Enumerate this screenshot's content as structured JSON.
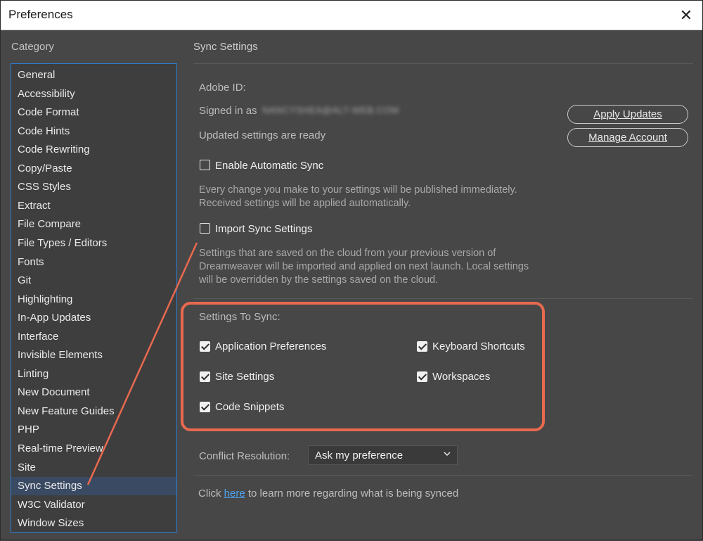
{
  "window": {
    "title": "Preferences",
    "close_glyph": "✕"
  },
  "sidebar": {
    "header": "Category",
    "items": [
      {
        "label": "General"
      },
      {
        "label": "Accessibility"
      },
      {
        "label": "Code Format"
      },
      {
        "label": "Code Hints"
      },
      {
        "label": "Code Rewriting"
      },
      {
        "label": "Copy/Paste"
      },
      {
        "label": "CSS Styles"
      },
      {
        "label": "Extract"
      },
      {
        "label": "File Compare"
      },
      {
        "label": "File Types / Editors"
      },
      {
        "label": "Fonts"
      },
      {
        "label": "Git"
      },
      {
        "label": "Highlighting"
      },
      {
        "label": "In-App Updates"
      },
      {
        "label": "Interface"
      },
      {
        "label": "Invisible Elements"
      },
      {
        "label": "Linting"
      },
      {
        "label": "New Document"
      },
      {
        "label": "New Feature Guides"
      },
      {
        "label": "PHP"
      },
      {
        "label": "Real-time Preview"
      },
      {
        "label": "Site"
      },
      {
        "label": "Sync Settings",
        "selected": true
      },
      {
        "label": "W3C Validator"
      },
      {
        "label": "Window Sizes"
      }
    ]
  },
  "main": {
    "section_title": "Sync Settings",
    "adobe_id_label": "Adobe ID:",
    "signed_in_label": "Signed in as",
    "signed_in_email": "NANCYSHEA@ALT-WEB.COM",
    "updated_status": "Updated settings are ready",
    "apply_updates_button": "Apply Updates",
    "manage_account_button": "Manage Account",
    "enable_auto_sync": {
      "label": "Enable Automatic Sync",
      "checked": false
    },
    "enable_auto_sync_desc_line1": "Every change you make to your settings will be published immediately.",
    "enable_auto_sync_desc_line2": "Received settings will be applied automatically.",
    "import_sync": {
      "label": "Import Sync Settings",
      "checked": false
    },
    "import_sync_desc_line1": "Settings that are saved on the cloud from your previous version of",
    "import_sync_desc_line2": "Dreamweaver will be imported and applied on next launch. Local settings",
    "import_sync_desc_line3": "will be overridden by the settings saved on the cloud.",
    "settings_to_sync_label": "Settings To Sync:",
    "sync_options": {
      "app_prefs": {
        "label": "Application Preferences",
        "checked": true
      },
      "keyboard_shortcuts": {
        "label": "Keyboard Shortcuts",
        "checked": true
      },
      "site_settings": {
        "label": "Site Settings",
        "checked": true
      },
      "workspaces": {
        "label": "Workspaces",
        "checked": true
      },
      "code_snippets": {
        "label": "Code Snippets",
        "checked": true
      }
    },
    "conflict_label": "Conflict Resolution:",
    "conflict_value": "Ask my preference",
    "footer_prefix": "Click ",
    "footer_link": "here",
    "footer_suffix": " to learn more regarding what is being synced"
  },
  "colors": {
    "accent": "#2d7dd2",
    "annotation": "#e8694f",
    "link": "#4ea2f1",
    "background": "#474747"
  }
}
